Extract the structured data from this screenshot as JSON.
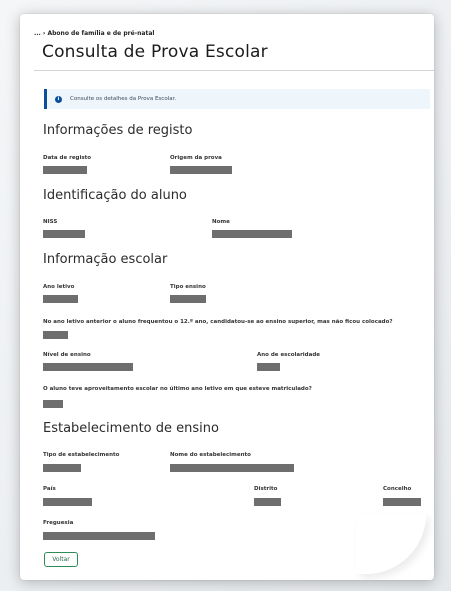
{
  "breadcrumb": "... › Abono de família e de pré-natal",
  "page_title": "Consulta de Prova Escolar",
  "alert": {
    "icon": "info-icon",
    "text": "Consulte os detalhes da Prova Escolar."
  },
  "sections": {
    "registo": {
      "title": "Informações de registo",
      "fields": {
        "data_registo": "Data de registo",
        "origem_prova": "Origem da prova"
      }
    },
    "aluno": {
      "title": "Identificação do aluno",
      "fields": {
        "niss": "NISS",
        "nome": "Nome"
      }
    },
    "escolar": {
      "title": "Informação escolar",
      "fields": {
        "ano_letivo": "Ano letivo",
        "tipo_ensino": "Tipo ensino",
        "pergunta_12ano": "No ano letivo anterior o aluno frequentou o 12.º ano, candidatou-se ao ensino superior, mas não ficou colocado?",
        "nivel_ensino": "Nível de ensino",
        "ano_escolaridade": "Ano de escolaridade",
        "pergunta_aproveitamento": "O aluno teve aproveitamento escolar no último ano letivo em que esteve matriculado?"
      }
    },
    "estabelecimento": {
      "title": "Estabelecimento de ensino",
      "fields": {
        "tipo_estabelecimento": "Tipo de estabelecimento",
        "nome_estabelecimento": "Nome do estabelecimento",
        "pais": "País",
        "distrito": "Distrito",
        "concelho": "Concelho",
        "freguesia": "Freguesia"
      }
    }
  },
  "actions": {
    "back_label": "Voltar"
  },
  "colors": {
    "accent": "#0b4f9c",
    "button_border": "#2e8b57",
    "redaction": "#6e6e6e"
  }
}
